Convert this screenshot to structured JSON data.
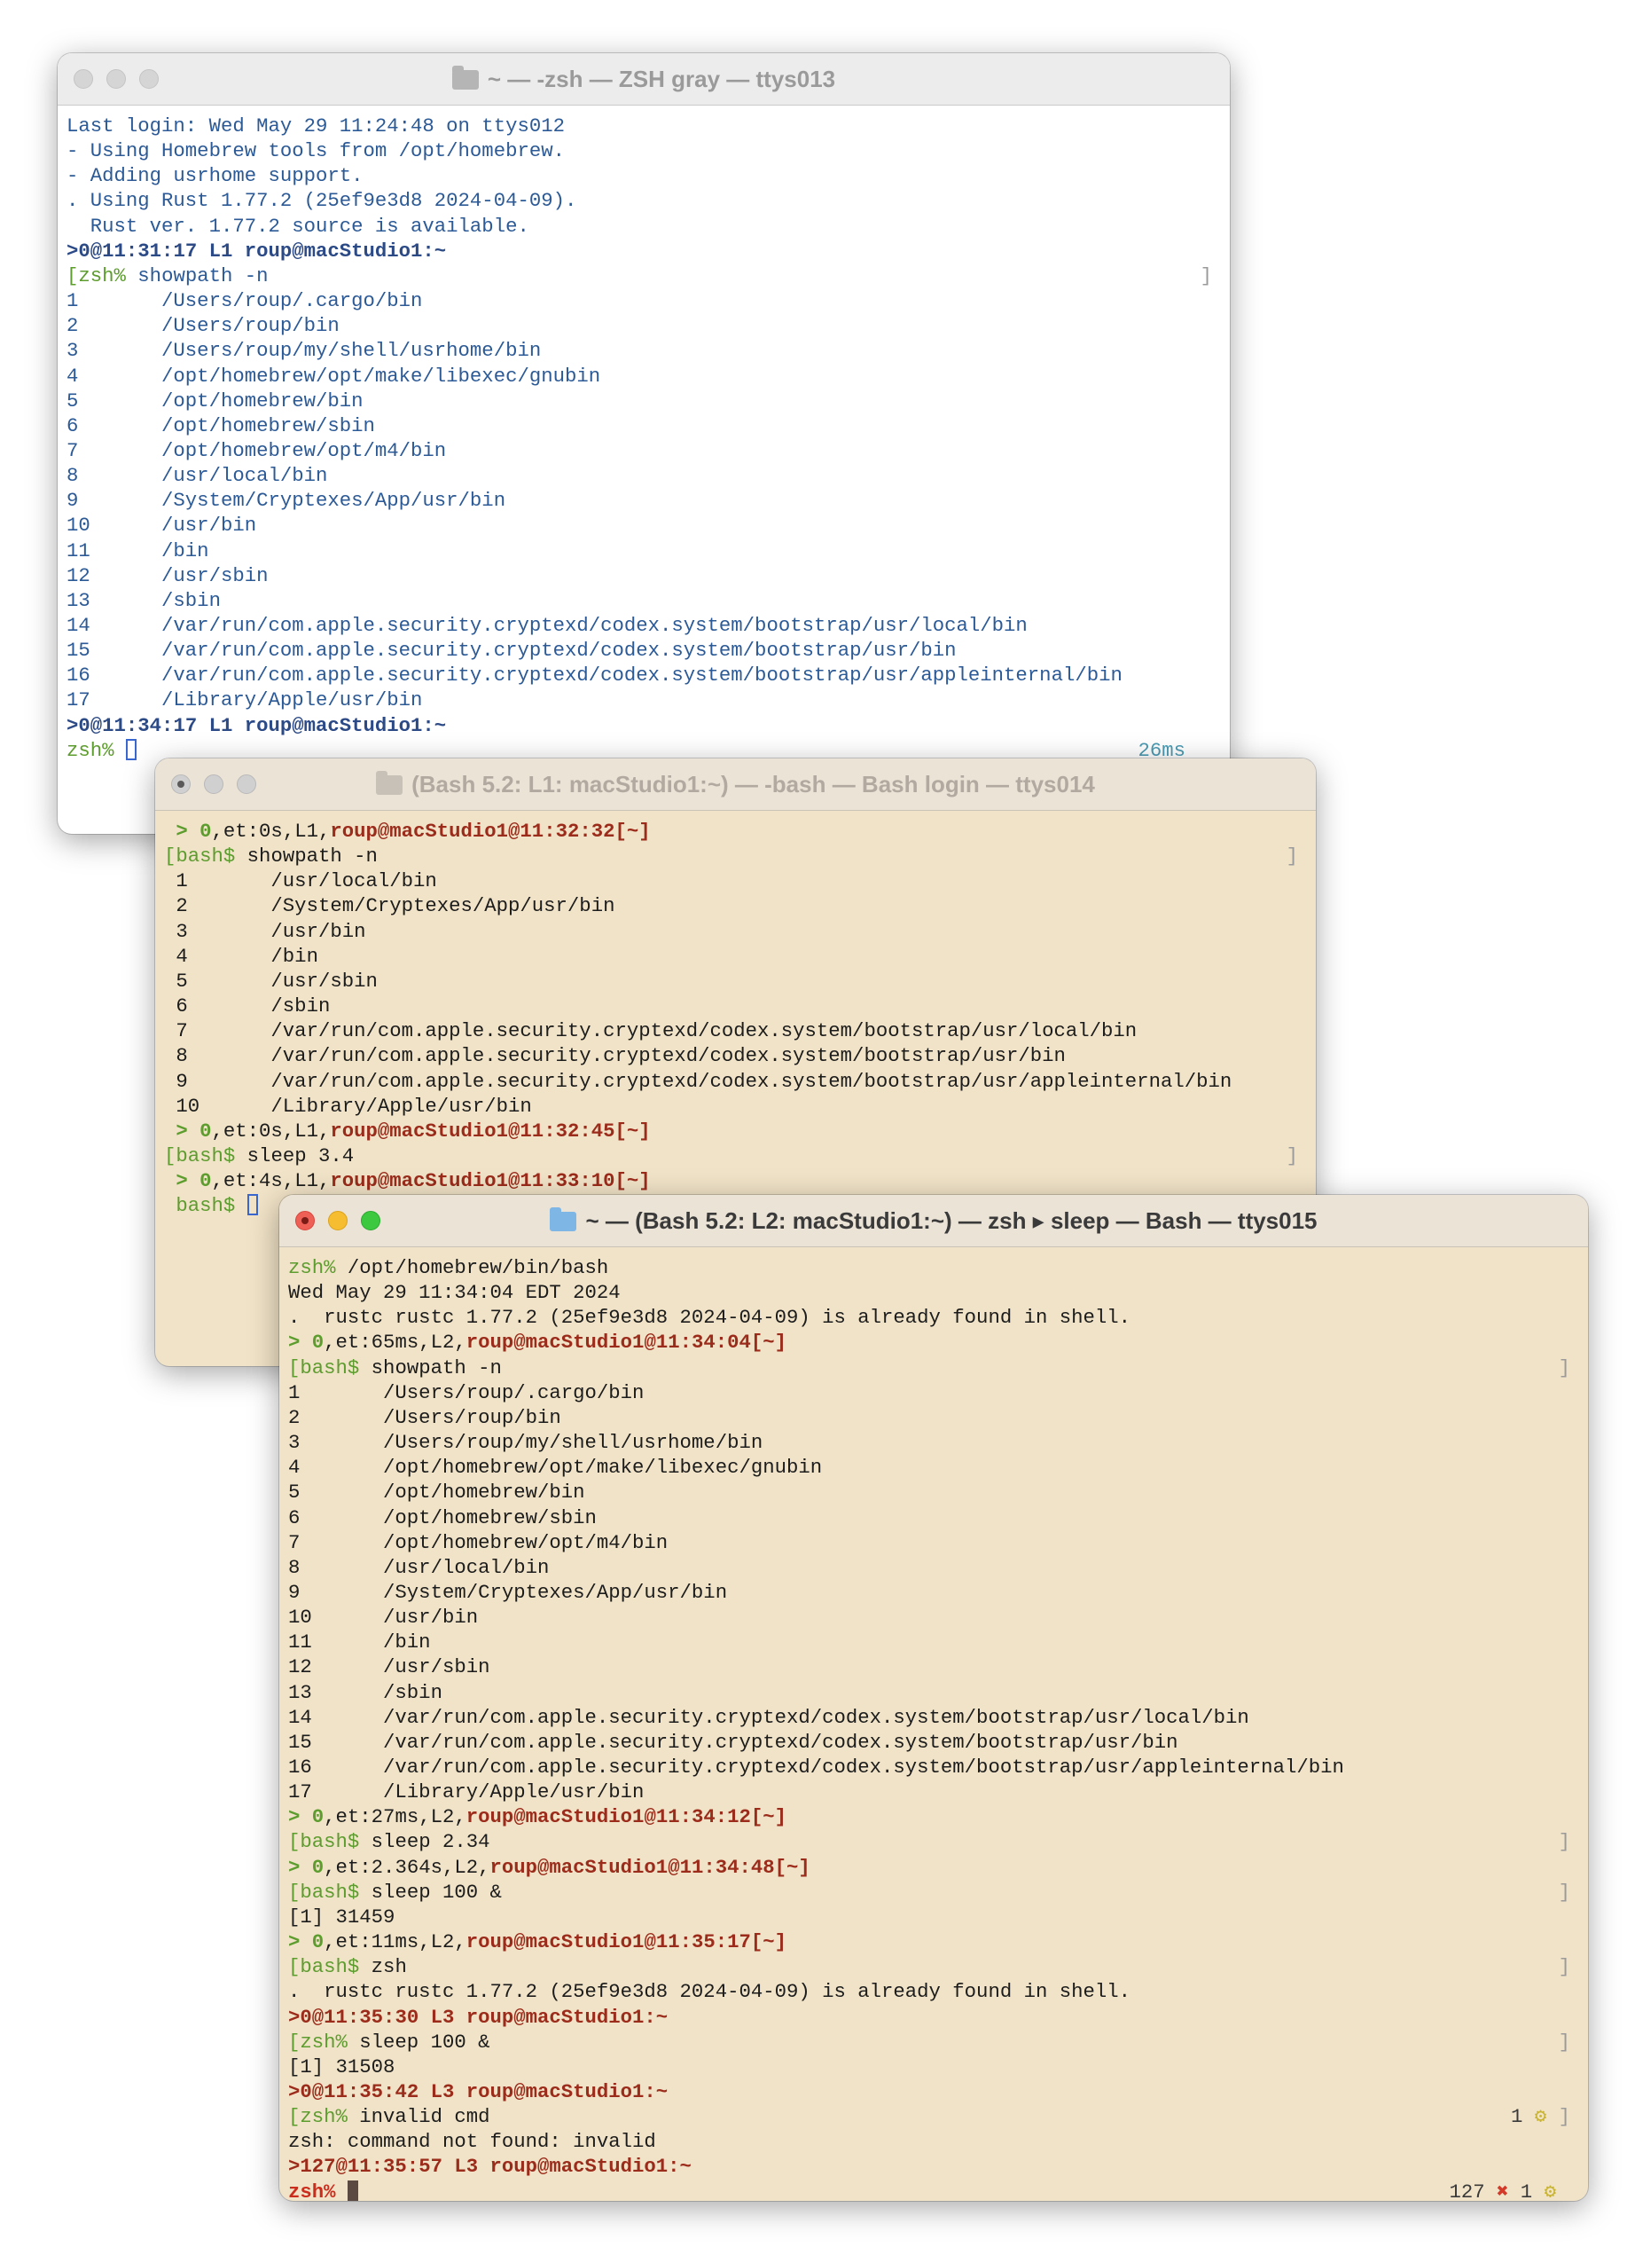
{
  "windows": {
    "w1": {
      "title": "~ — -zsh — ZSH gray — ttys013",
      "lines": [
        [
          {
            "t": "Last login: Wed May 29 11:24:48 on ttys012"
          }
        ],
        [
          {
            "t": "- Using Homebrew tools from /opt/homebrew."
          }
        ],
        [
          {
            "t": "- Adding usrhome support."
          }
        ],
        [
          {
            "t": ". Using Rust 1.77.2 (25ef9e3d8 2024-04-09)."
          }
        ],
        [
          {
            "t": "  Rust ver. 1.77.2 source is available."
          }
        ],
        [
          {
            "t": ">0@",
            "c": "nv"
          },
          {
            "t": "11:31:17 L1 roup@macStudio1:~",
            "c": "nv"
          }
        ],
        [
          {
            "t": "[",
            "c": "g"
          },
          {
            "t": "zsh%",
            "c": "g"
          },
          {
            "t": " showpath -n"
          }
        ],
        [
          {
            "t": "1       /Users/roup/.cargo/bin"
          }
        ],
        [
          {
            "t": "2       /Users/roup/bin"
          }
        ],
        [
          {
            "t": "3       /Users/roup/my/shell/usrhome/bin"
          }
        ],
        [
          {
            "t": "4       /opt/homebrew/opt/make/libexec/gnubin"
          }
        ],
        [
          {
            "t": "5       /opt/homebrew/bin"
          }
        ],
        [
          {
            "t": "6       /opt/homebrew/sbin"
          }
        ],
        [
          {
            "t": "7       /opt/homebrew/opt/m4/bin"
          }
        ],
        [
          {
            "t": "8       /usr/local/bin"
          }
        ],
        [
          {
            "t": "9       /System/Cryptexes/App/usr/bin"
          }
        ],
        [
          {
            "t": "10      /usr/bin"
          }
        ],
        [
          {
            "t": "11      /bin"
          }
        ],
        [
          {
            "t": "12      /usr/sbin"
          }
        ],
        [
          {
            "t": "13      /sbin"
          }
        ],
        [
          {
            "t": "14      /var/run/com.apple.security.cryptexd/codex.system/bootstrap/usr/local/bin"
          }
        ],
        [
          {
            "t": "15      /var/run/com.apple.security.cryptexd/codex.system/bootstrap/usr/bin"
          }
        ],
        [
          {
            "t": "16      /var/run/com.apple.security.cryptexd/codex.system/bootstrap/usr/appleinternal/bin"
          }
        ],
        [
          {
            "t": "17      /Library/Apple/usr/bin"
          }
        ],
        [
          {
            "t": ">0@",
            "c": "nv"
          },
          {
            "t": "11:34:17 L1 roup@macStudio1:~",
            "c": "nv"
          }
        ],
        [
          {
            "t": "zsh%",
            "c": "g"
          },
          {
            "t": " "
          },
          {
            "cursor": "hollow"
          }
        ]
      ],
      "right": {
        "6": "]",
        "25": "26ms"
      }
    },
    "w2": {
      "title": "(Bash 5.2: L1: macStudio1:~) — -bash — Bash login — ttys014",
      "lines": [
        [
          {
            "t": " > 0",
            "c": "gb"
          },
          {
            "t": ",et:0s,L1,"
          },
          {
            "t": "roup@macStudio1@11:32:32[~]",
            "c": "r"
          }
        ],
        [
          {
            "t": "[bash$",
            "c": "g"
          },
          {
            "t": " showpath -n"
          }
        ],
        [
          {
            "t": " 1       /usr/local/bin"
          }
        ],
        [
          {
            "t": " 2       /System/Cryptexes/App/usr/bin"
          }
        ],
        [
          {
            "t": " 3       /usr/bin"
          }
        ],
        [
          {
            "t": " 4       /bin"
          }
        ],
        [
          {
            "t": " 5       /usr/sbin"
          }
        ],
        [
          {
            "t": " 6       /sbin"
          }
        ],
        [
          {
            "t": " 7       /var/run/com.apple.security.cryptexd/codex.system/bootstrap/usr/local/bin"
          }
        ],
        [
          {
            "t": " 8       /var/run/com.apple.security.cryptexd/codex.system/bootstrap/usr/bin"
          }
        ],
        [
          {
            "t": " 9       /var/run/com.apple.security.cryptexd/codex.system/bootstrap/usr/appleinternal/bin"
          }
        ],
        [
          {
            "t": " 10      /Library/Apple/usr/bin"
          }
        ],
        [
          {
            "t": " > 0",
            "c": "gb"
          },
          {
            "t": ",et:0s,L1,"
          },
          {
            "t": "roup@macStudio1@11:32:45[~]",
            "c": "r"
          }
        ],
        [
          {
            "t": "[bash$",
            "c": "g"
          },
          {
            "t": " sleep 3.4"
          }
        ],
        [
          {
            "t": " > 0",
            "c": "gb"
          },
          {
            "t": ",et:4s,L1,"
          },
          {
            "t": "roup@macStudio1@11:33:10[~]",
            "c": "r"
          }
        ],
        [
          {
            "t": " bash$",
            "c": "g"
          },
          {
            "t": " "
          },
          {
            "cursor": "hollow"
          }
        ]
      ],
      "right": {
        "1": "]",
        "13": "]"
      }
    },
    "w3": {
      "title": "~ — (Bash 5.2: L2: macStudio1:~) — zsh ▸ sleep — Bash — ttys015",
      "lines": [
        [
          {
            "t": "zsh%",
            "c": "g"
          },
          {
            "t": " /opt/homebrew/bin/bash"
          }
        ],
        [
          {
            "t": "Wed May 29 11:34:04 EDT 2024"
          }
        ],
        [
          {
            "t": ".  rustc rustc 1.77.2 (25ef9e3d8 2024-04-09) is already found in shell."
          }
        ],
        [
          {
            "t": "> 0",
            "c": "gb"
          },
          {
            "t": ",et:65ms,L2,"
          },
          {
            "t": "roup@macStudio1@11:34:04[~]",
            "c": "r"
          }
        ],
        [
          {
            "t": "[bash$",
            "c": "g"
          },
          {
            "t": " showpath -n"
          }
        ],
        [
          {
            "t": "1       /Users/roup/.cargo/bin"
          }
        ],
        [
          {
            "t": "2       /Users/roup/bin"
          }
        ],
        [
          {
            "t": "3       /Users/roup/my/shell/usrhome/bin"
          }
        ],
        [
          {
            "t": "4       /opt/homebrew/opt/make/libexec/gnubin"
          }
        ],
        [
          {
            "t": "5       /opt/homebrew/bin"
          }
        ],
        [
          {
            "t": "6       /opt/homebrew/sbin"
          }
        ],
        [
          {
            "t": "7       /opt/homebrew/opt/m4/bin"
          }
        ],
        [
          {
            "t": "8       /usr/local/bin"
          }
        ],
        [
          {
            "t": "9       /System/Cryptexes/App/usr/bin"
          }
        ],
        [
          {
            "t": "10      /usr/bin"
          }
        ],
        [
          {
            "t": "11      /bin"
          }
        ],
        [
          {
            "t": "12      /usr/sbin"
          }
        ],
        [
          {
            "t": "13      /sbin"
          }
        ],
        [
          {
            "t": "14      /var/run/com.apple.security.cryptexd/codex.system/bootstrap/usr/local/bin"
          }
        ],
        [
          {
            "t": "15      /var/run/com.apple.security.cryptexd/codex.system/bootstrap/usr/bin"
          }
        ],
        [
          {
            "t": "16      /var/run/com.apple.security.cryptexd/codex.system/bootstrap/usr/appleinternal/bin"
          }
        ],
        [
          {
            "t": "17      /Library/Apple/usr/bin"
          }
        ],
        [
          {
            "t": "> 0",
            "c": "gb"
          },
          {
            "t": ",et:27ms,L2,"
          },
          {
            "t": "roup@macStudio1@11:34:12[~]",
            "c": "r"
          }
        ],
        [
          {
            "t": "[bash$",
            "c": "g"
          },
          {
            "t": " sleep 2.34"
          }
        ],
        [
          {
            "t": "> 0",
            "c": "gb"
          },
          {
            "t": ",et:2.364s,L2,"
          },
          {
            "t": "roup@macStudio1@11:34:48[~]",
            "c": "r"
          }
        ],
        [
          {
            "t": "[bash$",
            "c": "g"
          },
          {
            "t": " sleep 100 &"
          }
        ],
        [
          {
            "t": "[1] 31459"
          }
        ],
        [
          {
            "t": "> 0",
            "c": "gb"
          },
          {
            "t": ",et:11ms,L2,"
          },
          {
            "t": "roup@macStudio1@11:35:17[~]",
            "c": "r"
          }
        ],
        [
          {
            "t": "[bash$",
            "c": "g"
          },
          {
            "t": " zsh"
          }
        ],
        [
          {
            "t": ".  rustc rustc 1.77.2 (25ef9e3d8 2024-04-09) is already found in shell."
          }
        ],
        [
          {
            "t": ">0@",
            "c": "r"
          },
          {
            "t": "11:35:30 L3 roup@macStudio1:~",
            "c": "r"
          }
        ],
        [
          {
            "t": "[zsh%",
            "c": "g"
          },
          {
            "t": " sleep 100 &"
          }
        ],
        [
          {
            "t": "[1] 31508"
          }
        ],
        [
          {
            "t": ">0@",
            "c": "r"
          },
          {
            "t": "11:35:42 L3 roup@macStudio1:~",
            "c": "r"
          }
        ],
        [
          {
            "t": "[zsh%",
            "c": "g"
          },
          {
            "t": " invalid cmd"
          }
        ],
        [
          {
            "t": "zsh: command not found: invalid"
          }
        ],
        [
          {
            "t": ">127@",
            "c": "r"
          },
          {
            "t": "11:35:57 L3 roup@macStudio1:~",
            "c": "r"
          }
        ],
        [
          {
            "t": "zsh%",
            "c": "rd"
          },
          {
            "t": " "
          },
          {
            "cursor": "solid"
          }
        ]
      ],
      "right": {
        "4": "]",
        "23": "]",
        "25": "]",
        "28": "]",
        "31": "]",
        "34": "1 ⚙ ]",
        "37": "127 ✖ 1 ⚙"
      }
    }
  },
  "colors": {
    "zsh_text": "#2c5a96",
    "prompt_green": "#5d9c2e",
    "prompt_red": "#9b2b1b",
    "terminal_bg_bash": "#f1e3c7",
    "terminal_bg_zsh": "#ffffff",
    "light_close": "#ee5f56",
    "light_min": "#f5bd2f",
    "light_max": "#3cc83f",
    "light_inactive": "#cdcdcd"
  },
  "icons": {
    "folder": "folder-icon",
    "gear": "gear-icon",
    "cross": "cross-icon"
  }
}
